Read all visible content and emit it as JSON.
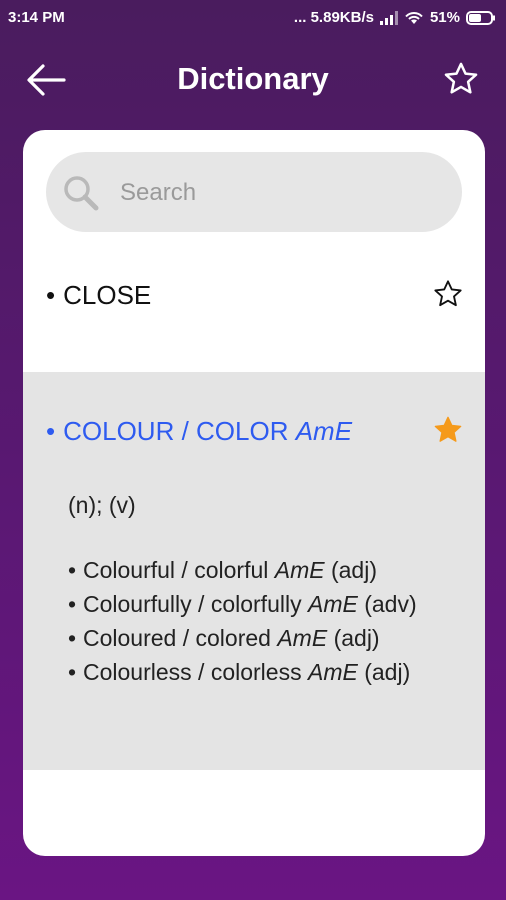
{
  "status": {
    "time": "3:14 PM",
    "net_speed": "... 5.89KB/s",
    "battery": "51%"
  },
  "header": {
    "title": "Dictionary"
  },
  "search": {
    "placeholder": "Search"
  },
  "entries": [
    {
      "head": "CLOSE",
      "starred": false
    },
    {
      "head": "COLOUR / COLOR",
      "head_variant": "AmE",
      "starred": true,
      "pos": "(n); (v)",
      "derivatives": [
        {
          "word": "Colourful / colorful",
          "variant": "AmE",
          "pos": "(adj)"
        },
        {
          "word": "Colourfully / colorfully",
          "variant": "AmE",
          "pos": "(adv)"
        },
        {
          "word": "Coloured / colored",
          "variant": "AmE",
          "pos": "(adj)"
        },
        {
          "word": "Colourless / colorless",
          "variant": "AmE",
          "pos": "(adj)"
        }
      ]
    }
  ],
  "colors": {
    "accent_blue": "#2e5bf0",
    "star_orange": "#f59a1b",
    "header_purple": "#4a1c5e"
  }
}
